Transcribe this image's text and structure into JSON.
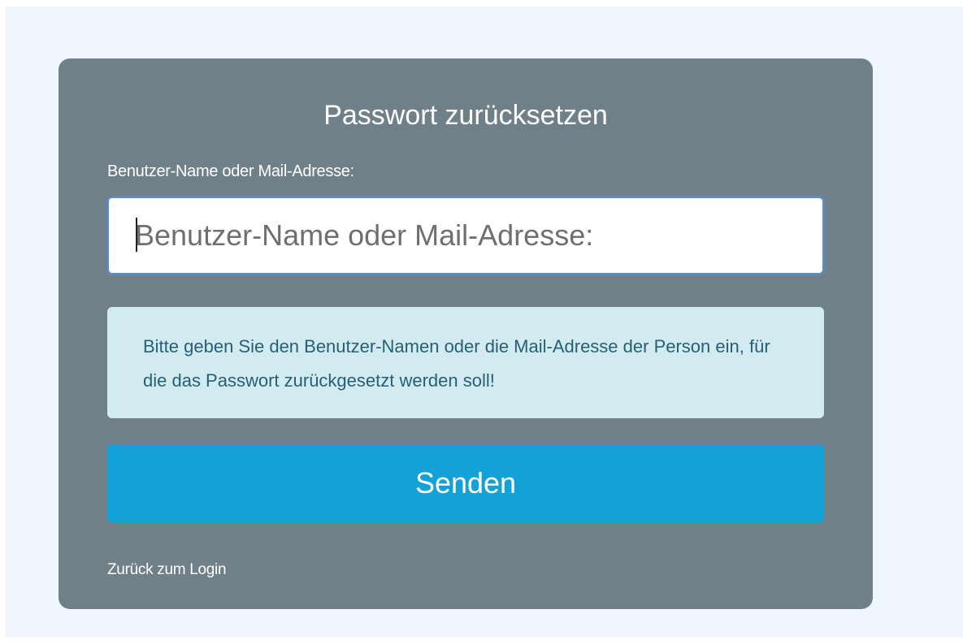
{
  "form": {
    "title": "Passwort zurücksetzen",
    "field_label": "Benutzer-Name oder Mail-Adresse:",
    "input_placeholder": "Benutzer-Name oder Mail-Adresse:",
    "input_value": "",
    "hint": "Bitte geben Sie den Benutzer-Namen oder die Mail-Adresse der Person ein, für die das Passwort zurückgesetzt werden soll!",
    "submit_label": "Senden",
    "back_link": "Zurück zum Login"
  },
  "colors": {
    "page_background": "#eff6fd",
    "card_background": "#708088",
    "hint_background": "#d1ebf0",
    "hint_text": "#276074",
    "button_background": "#13a2d7",
    "input_focus_border": "#5b8dc9"
  }
}
